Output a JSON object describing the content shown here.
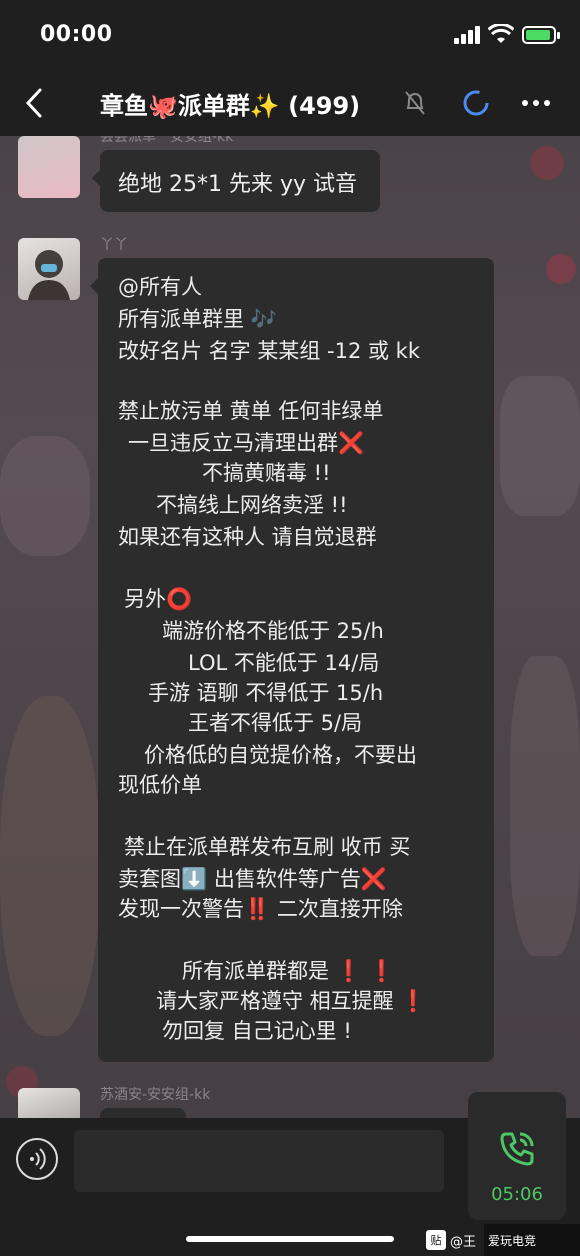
{
  "status": {
    "time": "00:00",
    "battery_color": "#4cd964"
  },
  "nav": {
    "title": "章鱼🐙派单群✨ (499)",
    "back_icon": "chevron-left-icon",
    "mute_icon": "bell-slash-icon",
    "more_icon": "ellipsis-icon"
  },
  "messages": [
    {
      "sender_faded": "尝尝派单一安安组-kk",
      "text": "绝地 25*1 先来 yy 试音"
    },
    {
      "sender_faded": "丫丫",
      "lines": [
        "@所有人",
        "所有派单群里 🎶",
        "改好名片  名字  某某组 -12 或 kk",
        "禁止放污单 黄单  任何非绿单",
        "一旦违反立马清理出群❌",
        "不搞黄赌毒 !!",
        "不搞线上网络卖淫 !!",
        "如果还有这种人 请自觉退群",
        "另外⭕",
        "端游价格不能低于 25/h",
        "LOL 不能低于 14/局",
        "手游  语聊  不得低于 15/h",
        "王者不得低于 5/局",
        "价格低的自觉提价格，不要出",
        "现低价单",
        "禁止在派单群发布互刷 收币 买",
        "卖套图⬇️ 出售软件等广告❌",
        "发现一次警告‼️ 二次直接开除",
        "所有派单群都是 ❗ ❗",
        "请大家严格遵守 相互提醒 ❗",
        "勿回复    自己记心里 !"
      ]
    },
    {
      "sender_faded": "苏酒安-安安组-kk"
    }
  ],
  "input": {
    "voice_icon": "voice-icon"
  },
  "call": {
    "duration": "05:06",
    "color": "#4cc764"
  },
  "watermark": {
    "badge": "贴",
    "text": "@王"
  },
  "logo": {
    "text": "爱玩电竞"
  }
}
